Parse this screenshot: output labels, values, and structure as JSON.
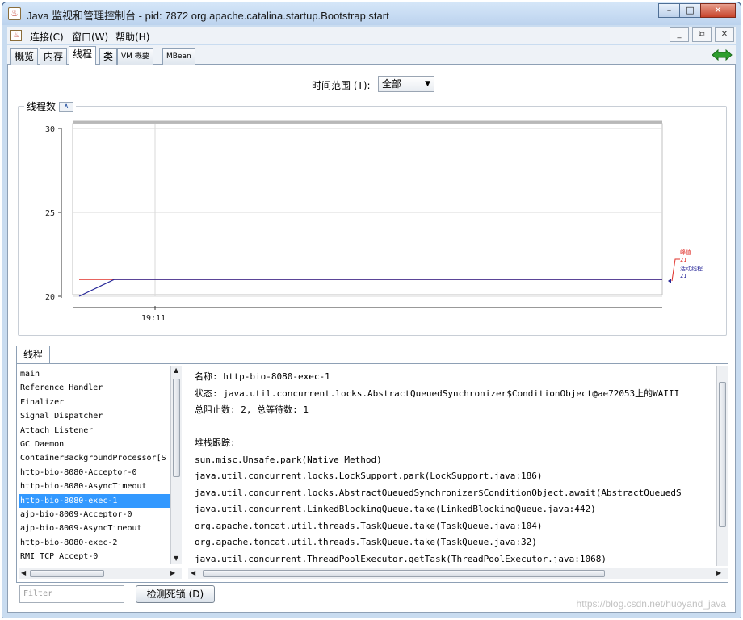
{
  "window": {
    "title": "Java 监视和管理控制台 - pid: 7872 org.apache.catalina.startup.Bootstrap start",
    "buttons": {
      "minimize": "–",
      "maximize": "□",
      "close": "✕"
    }
  },
  "menu": {
    "items": [
      "连接(C)",
      "窗口(W)",
      "帮助(H)"
    ],
    "mdi_buttons": [
      "_",
      "⧉",
      "✕"
    ]
  },
  "tabs": [
    {
      "label": "概览"
    },
    {
      "label": "内存"
    },
    {
      "label": "线程",
      "active": true
    },
    {
      "label": "类"
    },
    {
      "label": "VM 概要"
    },
    {
      "label": "MBean"
    }
  ],
  "time_range": {
    "label": "时间范围 (T):",
    "selected": "全部"
  },
  "chart_data": {
    "type": "line",
    "title": "线程数",
    "collapse_label": "∧",
    "x_ticks": [
      {
        "value": "19:11",
        "at": 0
      }
    ],
    "ylim": [
      20,
      30
    ],
    "y_ticks": [
      20,
      25,
      30
    ],
    "series": [
      {
        "name": "峰值",
        "color": "#e0302a",
        "points": [
          [
            0,
            21
          ],
          [
            1,
            21
          ]
        ],
        "current": "21"
      },
      {
        "name": "活动线程",
        "color": "#2a2a9a",
        "points": [
          [
            0,
            20
          ],
          [
            0.06,
            21
          ],
          [
            1,
            21
          ]
        ],
        "current": "21"
      }
    ]
  },
  "threads": {
    "tab_label": "线程",
    "list": [
      "main",
      "Reference Handler",
      "Finalizer",
      "Signal Dispatcher",
      "Attach Listener",
      "GC Daemon",
      "ContainerBackgroundProcessor[S",
      "http-bio-8080-Acceptor-0",
      "http-bio-8080-AsyncTimeout",
      "http-bio-8080-exec-1",
      "ajp-bio-8009-Acceptor-0",
      "ajp-bio-8009-AsyncTimeout",
      "http-bio-8080-exec-2",
      "RMI TCP Accept-0"
    ],
    "selected_index": 9,
    "detail_lines": [
      "名称: http-bio-8080-exec-1",
      "状态: java.util.concurrent.locks.AbstractQueuedSynchronizer$ConditionObject@ae72053上的WAIII",
      "总阻止数: 2, 总等待数: 1",
      "",
      "堆栈跟踪:",
      "sun.misc.Unsafe.park(Native Method)",
      "java.util.concurrent.locks.LockSupport.park(LockSupport.java:186)",
      "java.util.concurrent.locks.AbstractQueuedSynchronizer$ConditionObject.await(AbstractQueuedS",
      "java.util.concurrent.LinkedBlockingQueue.take(LinkedBlockingQueue.java:442)",
      "org.apache.tomcat.util.threads.TaskQueue.take(TaskQueue.java:104)",
      "org.apache.tomcat.util.threads.TaskQueue.take(TaskQueue.java:32)",
      "java.util.concurrent.ThreadPoolExecutor.getTask(ThreadPoolExecutor.java:1068)"
    ],
    "filter_placeholder": "Filter",
    "deadlock_button": "检测死锁 (D)"
  },
  "watermark": "https://blog.csdn.net/huoyand_java",
  "colors": {
    "accent": "#3399ff",
    "peak": "#e0302a",
    "live": "#2a2a9a"
  }
}
